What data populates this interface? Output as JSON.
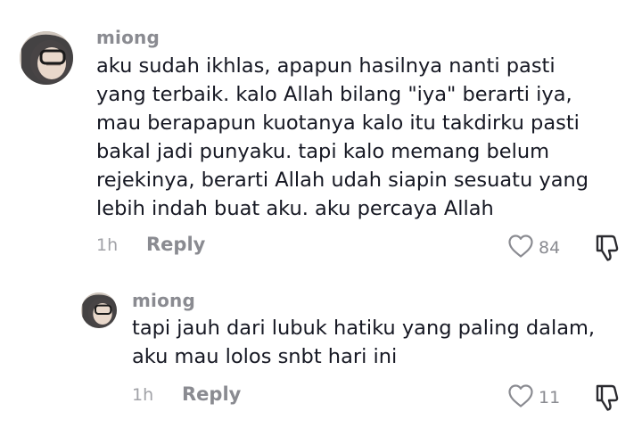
{
  "comments": [
    {
      "username": "miong",
      "text_lines": [
        "aku sudah ikhlas, apapun hasilnya nanti pasti",
        "yang terbaik. kalo Allah bilang \"iya\" berarti iya,",
        "mau berapapun kuotanya kalo itu takdirku pasti",
        "bakal jadi punyaku. tapi kalo memang belum",
        "rejekinya, berarti Allah udah siapin sesuatu yang",
        "lebih indah buat aku. aku percaya Allah"
      ],
      "time": "1h",
      "reply_label": "Reply",
      "likes": "84",
      "like_icon": "heart-outline-icon",
      "dislike_icon": "thumbs-down-icon"
    },
    {
      "username": "miong",
      "text_lines": [
        "tapi jauh dari lubuk hatiku yang paling dalam,",
        "aku mau lolos snbt hari ini"
      ],
      "time": "1h",
      "reply_label": "Reply",
      "likes": "11",
      "like_icon": "heart-outline-icon",
      "dislike_icon": "thumbs-down-icon"
    }
  ],
  "colors": {
    "text": "#161823",
    "username": "#8a8b91",
    "meta": "#a1a2a7",
    "background": "#ffffff"
  }
}
